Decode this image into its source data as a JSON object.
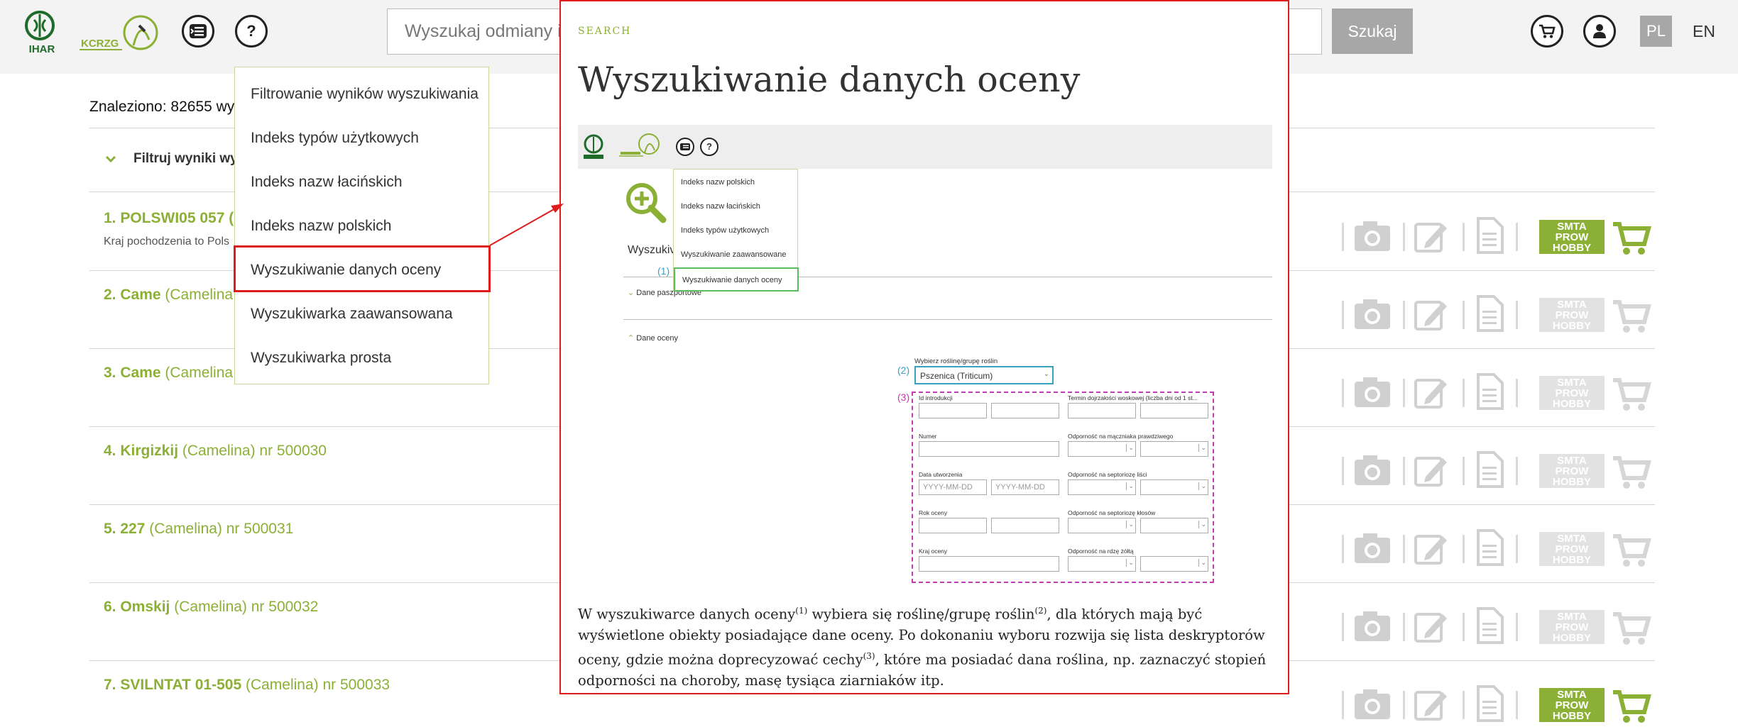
{
  "header": {
    "logo_ihar": "IHAR",
    "logo_kcrzg": "KCRZG",
    "index_button_icon": "list-icon",
    "help_button_label": "?",
    "search_placeholder": "Wyszukaj odmiany i",
    "search_button": "Szukaj",
    "cart_icon": "cart-icon",
    "user_icon": "user-icon",
    "lang_pl": "PL",
    "lang_en": "EN"
  },
  "results": {
    "found_text": "Znaleziono: 82655 wy",
    "filter_label": "Filtruj wyniki wy",
    "items": [
      {
        "title": "1. POLSWI05 057 (",
        "rest": "",
        "origin": "Kraj pochodzenia to Pols",
        "status": "green"
      },
      {
        "title": "2. Came",
        "rest": " (Camelina",
        "status": "grey"
      },
      {
        "title": "3. Came",
        "rest": " (Camelina",
        "status": "grey"
      },
      {
        "title": "4. Kirgizkij",
        "rest": " (Camelina) nr 500030",
        "status": "grey"
      },
      {
        "title": "5. 227",
        "rest": " (Camelina) nr 500031",
        "status": "grey"
      },
      {
        "title": "6. Omskij",
        "rest": " (Camelina) nr 500032",
        "status": "grey"
      },
      {
        "title": "7. SVILNTAT 01-505",
        "rest": " (Camelina) nr 500033",
        "status": "green"
      }
    ],
    "badge": [
      "SMTA",
      "PROW",
      "HOBBY"
    ]
  },
  "help_menu": {
    "items": [
      "Filtrowanie wyników wyszukiwania",
      "Indeks typów użytkowych",
      "Indeks nazw łacińskich",
      "Indeks nazw polskich",
      "Wyszukiwanie danych oceny",
      "Wyszukiwarka zaawansowana",
      "Wyszukiwarka prosta"
    ]
  },
  "callout": {
    "kicker": "SEARCH",
    "title": "Wyszukiwanie danych oceny",
    "mini": {
      "menu_items": [
        "Indeks nazw polskich",
        "Indeks nazw łacińskich",
        "Indeks typów użytkowych",
        "Wyszukiwanie zaawansowane",
        "Wyszukiwanie danych oceny"
      ],
      "heading_cut": "Wyszukiv",
      "n1": "(1)",
      "n2": "(2)",
      "n3": "(3)",
      "dane_paszportowe": "Dane paszportowe",
      "dane_oceny": "Dane oceny",
      "select_label": "Wybierz roślinę/grupę roślin",
      "select_value": "Pszenica (Triticum)",
      "fields_left": [
        "Id introdukcji",
        "Numer",
        "Data utworzenia",
        "Rok oceny",
        "Kraj oceny"
      ],
      "fields_right": [
        "Termin dojrzałości woskowej (liczba dni od 1 st...",
        "Odporność na mączniaka prawdziwego",
        "Odporność na septoriozę liści",
        "Odporność na septoriozę kłosów",
        "Odporność na rdzę żółtą"
      ],
      "date_placeholder": "YYYY-MM-DD"
    },
    "desc": {
      "p1": "W wyszukiwarce danych oceny",
      "s1": "(1)",
      "p2": " wybiera się roślinę/grupę roślin",
      "s2": "(2)",
      "p3": ", dla których mają być wyświetlone obiekty posiadające dane oceny. Po dokonaniu wyboru rozwija się lista deskryptorów oceny, gdzie można doprecyzować cechy",
      "s3": "(3)",
      "p4": ", które ma posiadać dana roślina, np. zaznaczyć stopień odporności na choroby, masę tysiąca ziarniaków itp."
    }
  },
  "colors": {
    "accent_green": "#8bb035",
    "highlight_red": "#e01b1b",
    "badge_green": "#8bb035",
    "icon_grey": "#d0d0d0"
  }
}
